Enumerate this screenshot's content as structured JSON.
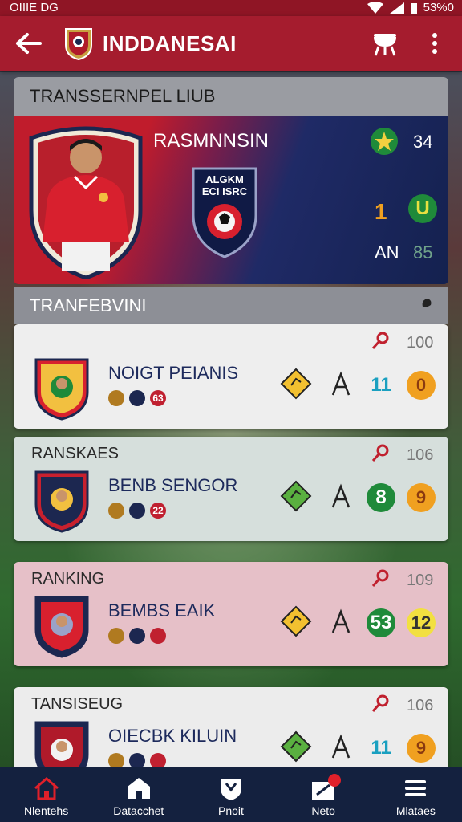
{
  "status_bar": {
    "left_text": "OIIIE DG",
    "right_text": "53%0"
  },
  "app_bar": {
    "title": "INDDANESAI"
  },
  "hero": {
    "header": "TRANSSERNPEL LIUB",
    "player_name": "RASMNNSIN",
    "crest_text_line1": "ALGKM",
    "crest_text_line2": "ECI ISRC",
    "stat_top": "34",
    "stat_mid": "1",
    "stat_badge": "U",
    "stat_label": "AN",
    "stat_label2": "85"
  },
  "section": {
    "header": "TRANFEBVINI"
  },
  "cards": [
    {
      "header": "",
      "name": "NOIGT PEIANIS",
      "score": "100",
      "minis": [
        "",
        "",
        "63"
      ],
      "stat_a": "11",
      "stat_b": "0",
      "bg": "#eeeeee"
    },
    {
      "header": "RANSKAES",
      "name": "BENB SENGOR",
      "score": "106",
      "minis": [
        "",
        "",
        "22"
      ],
      "stat_a": "8",
      "stat_b": "9",
      "bg": "#d6dfdc"
    },
    {
      "header": "RANKING",
      "name": "BEMBS EAIK",
      "score": "109",
      "minis": [
        "",
        "",
        ""
      ],
      "stat_a": "53",
      "stat_b": "12",
      "bg": "#e6c0c8"
    },
    {
      "header": "TANSISEUG",
      "name": "OIECBK KILUIN",
      "score": "106",
      "minis": [
        "",
        "",
        ""
      ],
      "stat_a": "11",
      "stat_b": "9",
      "bg": "#ececec"
    }
  ],
  "bottom_nav": [
    {
      "label": "Nlentehs",
      "icon": "home-icon"
    },
    {
      "label": "Datacchet",
      "icon": "house-icon"
    },
    {
      "label": "Pnoit",
      "icon": "shield-icon"
    },
    {
      "label": "Neto",
      "icon": "transfer-icon"
    },
    {
      "label": "Mlataes",
      "icon": "menu-icon"
    }
  ],
  "colors": {
    "brand_red": "#a51c2e",
    "nav_bg": "#14213f",
    "accent_green": "#1f8a3a",
    "accent_orange": "#f0a020"
  }
}
